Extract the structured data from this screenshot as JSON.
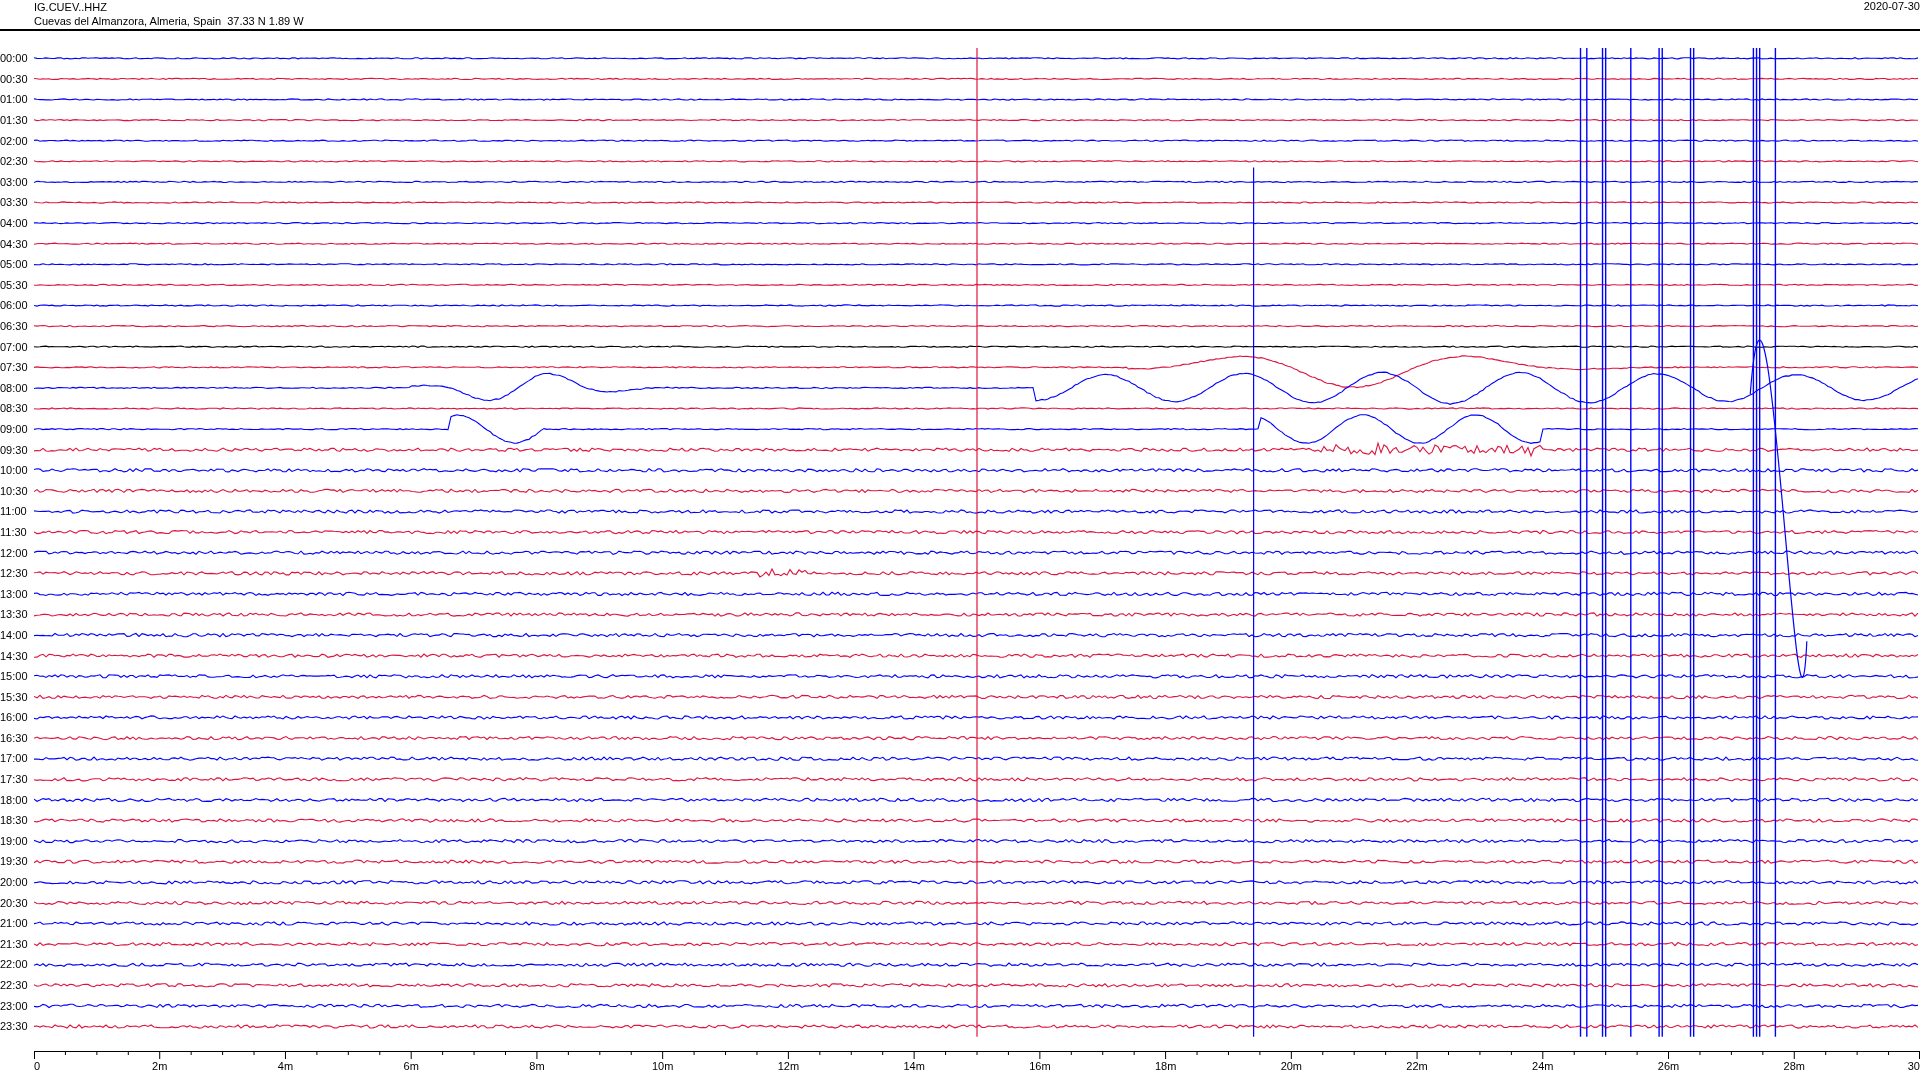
{
  "header": {
    "station": "IG.CUEV..HHZ",
    "location": "Cuevas del Almanzora, Almeria, Spain  37.33 N 1.89 W",
    "date": "2020-07-30"
  },
  "rows": [
    {
      "label": "00:00",
      "color": "#0000ff"
    },
    {
      "label": "00:30",
      "color": "#dc143c"
    },
    {
      "label": "01:00",
      "color": "#0000ff"
    },
    {
      "label": "01:30",
      "color": "#dc143c"
    },
    {
      "label": "02:00",
      "color": "#0000ff"
    },
    {
      "label": "02:30",
      "color": "#dc143c"
    },
    {
      "label": "03:00",
      "color": "#0000ff"
    },
    {
      "label": "03:30",
      "color": "#dc143c"
    },
    {
      "label": "04:00",
      "color": "#0000ff"
    },
    {
      "label": "04:30",
      "color": "#dc143c"
    },
    {
      "label": "05:00",
      "color": "#0000ff"
    },
    {
      "label": "05:30",
      "color": "#dc143c"
    },
    {
      "label": "06:00",
      "color": "#0000ff"
    },
    {
      "label": "06:30",
      "color": "#dc143c"
    },
    {
      "label": "07:00",
      "color": "#000000"
    },
    {
      "label": "07:30",
      "color": "#dc143c"
    },
    {
      "label": "08:00",
      "color": "#0000ff"
    },
    {
      "label": "08:30",
      "color": "#dc143c"
    },
    {
      "label": "09:00",
      "color": "#0000ff"
    },
    {
      "label": "09:30",
      "color": "#dc143c"
    },
    {
      "label": "10:00",
      "color": "#0000ff"
    },
    {
      "label": "10:30",
      "color": "#dc143c"
    },
    {
      "label": "11:00",
      "color": "#0000ff"
    },
    {
      "label": "11:30",
      "color": "#dc143c"
    },
    {
      "label": "12:00",
      "color": "#0000ff"
    },
    {
      "label": "12:30",
      "color": "#dc143c"
    },
    {
      "label": "13:00",
      "color": "#0000ff"
    },
    {
      "label": "13:30",
      "color": "#dc143c"
    },
    {
      "label": "14:00",
      "color": "#0000ff"
    },
    {
      "label": "14:30",
      "color": "#dc143c"
    },
    {
      "label": "15:00",
      "color": "#0000ff"
    },
    {
      "label": "15:30",
      "color": "#dc143c"
    },
    {
      "label": "16:00",
      "color": "#0000ff"
    },
    {
      "label": "16:30",
      "color": "#dc143c"
    },
    {
      "label": "17:00",
      "color": "#0000ff"
    },
    {
      "label": "17:30",
      "color": "#dc143c"
    },
    {
      "label": "18:00",
      "color": "#0000ff"
    },
    {
      "label": "18:30",
      "color": "#dc143c"
    },
    {
      "label": "19:00",
      "color": "#0000ff"
    },
    {
      "label": "19:30",
      "color": "#dc143c"
    },
    {
      "label": "20:00",
      "color": "#0000ff"
    },
    {
      "label": "20:30",
      "color": "#dc143c"
    },
    {
      "label": "21:00",
      "color": "#0000ff"
    },
    {
      "label": "21:30",
      "color": "#dc143c"
    },
    {
      "label": "22:00",
      "color": "#0000ff"
    },
    {
      "label": "22:30",
      "color": "#dc143c"
    },
    {
      "label": "23:00",
      "color": "#0000ff"
    },
    {
      "label": "23:30",
      "color": "#dc143c"
    }
  ],
  "x_axis": {
    "ticks": [
      "0",
      "2m",
      "4m",
      "6m",
      "8m",
      "10m",
      "12m",
      "14m",
      "16m",
      "18m",
      "20m",
      "22m",
      "24m",
      "26m",
      "28m",
      "30"
    ]
  }
}
